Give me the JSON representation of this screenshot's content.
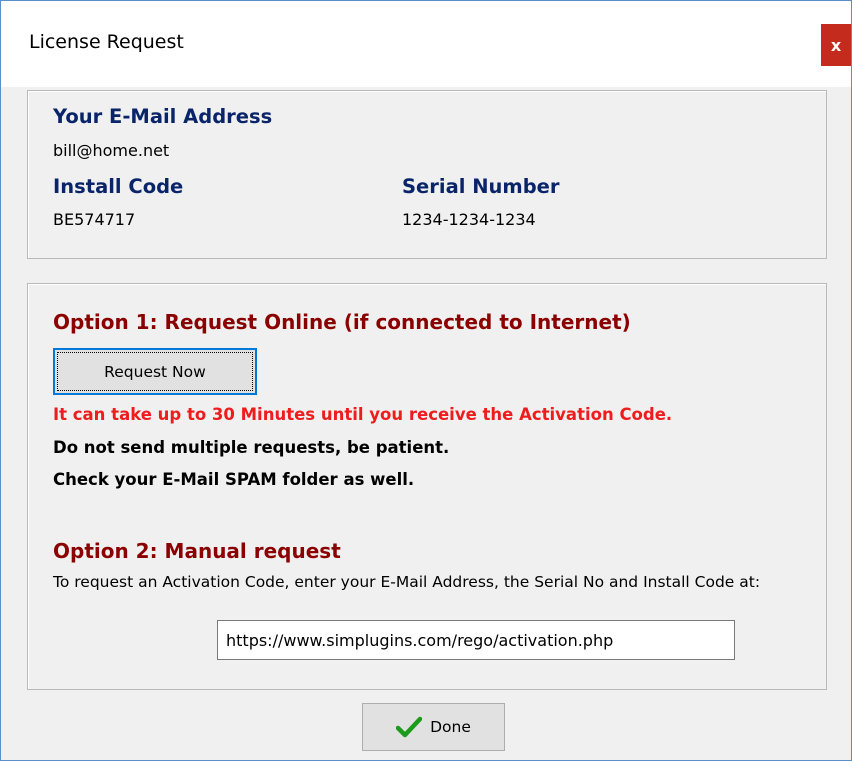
{
  "window": {
    "title": "License Request",
    "close_glyph": "x"
  },
  "account": {
    "email_label": "Your E-Mail Address",
    "email_value": "bill@home.net",
    "install_label": "Install Code",
    "install_value": "BE574717",
    "serial_label": "Serial Number",
    "serial_value": "1234-1234-1234"
  },
  "option1": {
    "title": "Option 1:  Request Online (if connected to Internet)",
    "button_label": "Request Now",
    "warning": "It can take up to 30 Minutes until you receive the Activation Code.",
    "note1": "Do not send multiple requests, be patient.",
    "note2": "Check your E-Mail SPAM folder as well."
  },
  "option2": {
    "title": "Option 2: Manual request",
    "description": "To request an Activation Code, enter your E-Mail Address, the Serial No and Install Code at:",
    "url": "https://www.simplugins.com/rego/activation.php"
  },
  "footer": {
    "done_label": "Done",
    "done_icon": "checkmark-icon"
  },
  "colors": {
    "heading_blue": "#0a246a",
    "heading_red": "#8b0000",
    "warning_red": "#ee1c1c",
    "close_red": "#c42b1c",
    "focus_blue": "#0078d7",
    "check_green": "#1a9c1a"
  }
}
